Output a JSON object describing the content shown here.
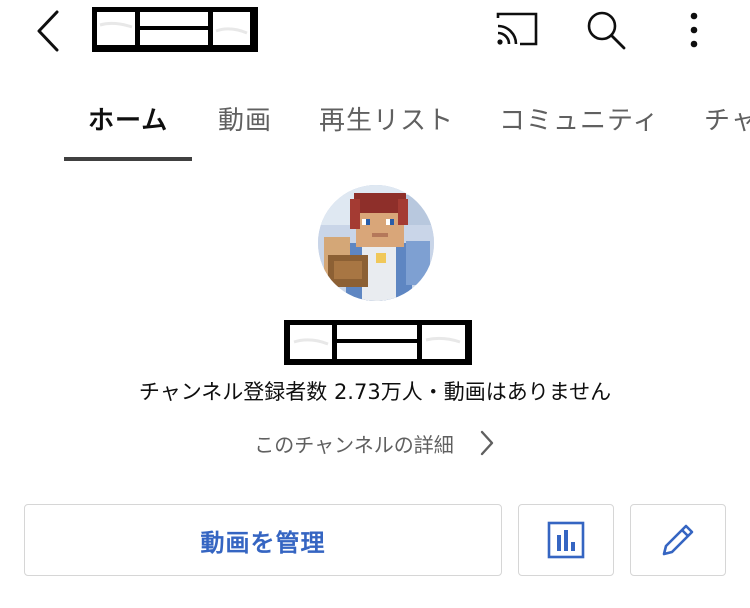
{
  "header": {
    "back_icon": "chevron-left-icon",
    "title": "",
    "cast_icon": "cast-icon",
    "search_icon": "search-icon",
    "more_icon": "more-vertical-icon"
  },
  "tabs": [
    {
      "label": "ホーム",
      "active": true
    },
    {
      "label": "動画",
      "active": false
    },
    {
      "label": "再生リスト",
      "active": false
    },
    {
      "label": "コミュニティ",
      "active": false
    },
    {
      "label": "チャ",
      "active": false
    }
  ],
  "channel": {
    "name": "",
    "stats": "チャンネル登録者数 2.73万人・動画はありません",
    "details_label": "このチャンネルの詳細"
  },
  "actions": {
    "manage_label": "動画を管理",
    "analytics_icon": "bar-chart-icon",
    "edit_icon": "pencil-icon"
  },
  "colors": {
    "accent": "#3565c2",
    "border": "#d6d6d6",
    "secondary_text": "#606060"
  }
}
